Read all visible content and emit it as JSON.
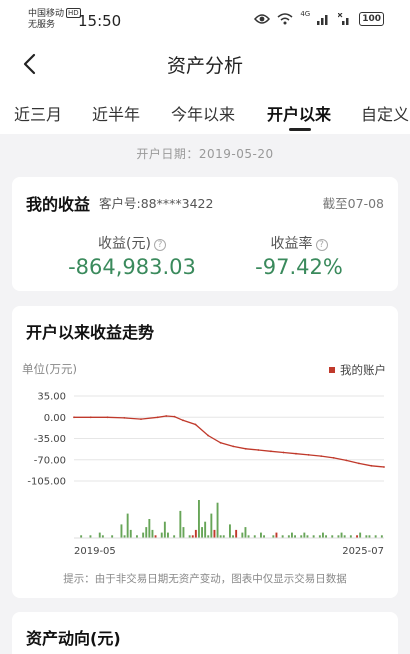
{
  "status_bar": {
    "carrier_line1": "中国移动",
    "carrier_badge": "HD",
    "carrier_line2": "无服务",
    "time": "15:50",
    "signal_label": "4G",
    "battery": "100"
  },
  "header": {
    "title": "资产分析"
  },
  "tabs": [
    {
      "label": "近三月",
      "active": false
    },
    {
      "label": "近半年",
      "active": false
    },
    {
      "label": "今年以来",
      "active": false
    },
    {
      "label": "开户以来",
      "active": true
    },
    {
      "label": "自定义",
      "active": false
    }
  ],
  "open_date": "开户日期：2019-05-20",
  "earnings_card": {
    "title": "我的收益",
    "customer_no": "客户号:88****3422",
    "as_of": "截至07-08",
    "profit_label": "收益(元)",
    "profit_value": "-864,983.03",
    "rate_label": "收益率",
    "rate_value": "-97.42%",
    "help_icon": "question-circle-icon",
    "value_color": "#3a8a5c"
  },
  "trend_card": {
    "title": "开户以来收益走势",
    "unit": "单位(万元)",
    "legend": "我的账户",
    "hint": "提示：由于非交易日期无资产变动，图表中仅显示交易日数据"
  },
  "chart_data": {
    "type": "line",
    "series": [
      {
        "name": "我的账户",
        "color": "#c0392b",
        "x": [
          "2019-05",
          "2019-09",
          "2020-01",
          "2020-05",
          "2020-09",
          "2021-01",
          "2021-03",
          "2021-05",
          "2021-07",
          "2021-10",
          "2022-01",
          "2022-04",
          "2022-07",
          "2022-10",
          "2023-01",
          "2023-04",
          "2023-07",
          "2023-10",
          "2024-01",
          "2024-04",
          "2024-07",
          "2024-10",
          "2025-01",
          "2025-04",
          "2025-07"
        ],
        "y": [
          0,
          0,
          0,
          -1,
          -3,
          0,
          2,
          1,
          -5,
          -12,
          -30,
          -42,
          -48,
          -52,
          -54,
          -56,
          -58,
          -60,
          -62,
          -64,
          -67,
          -71,
          -76,
          -80,
          -82
        ]
      }
    ],
    "bars": [
      0,
      0,
      1,
      0,
      0,
      1,
      0,
      0,
      2,
      1,
      0,
      0,
      1,
      0,
      0,
      5,
      1,
      9,
      3,
      0,
      1,
      0,
      2,
      4,
      7,
      3,
      1,
      0,
      2,
      6,
      2,
      0,
      1,
      0,
      10,
      4,
      0,
      1,
      1,
      3,
      14,
      4,
      6,
      1,
      9,
      3,
      13,
      1,
      1,
      0,
      5,
      1,
      3,
      0,
      2,
      4,
      1,
      0,
      1,
      0,
      2,
      1,
      0,
      0,
      1,
      2,
      0,
      1,
      0,
      1,
      2,
      1,
      0,
      1,
      2,
      1,
      0,
      1,
      0,
      1,
      2,
      1,
      0,
      1,
      0,
      1,
      2,
      1,
      0,
      1,
      0,
      1,
      2,
      0,
      1,
      1,
      0,
      1,
      0,
      1
    ],
    "bar_colors": [
      "#67a558",
      "#c0392b"
    ],
    "x_tick_labels": [
      "2019-05",
      "2025-07"
    ],
    "y_ticks": [
      35,
      0,
      -35,
      -70,
      -105
    ],
    "y_tick_labels": [
      "35.00",
      "0.00",
      "-35.00",
      "-70.00",
      "-105.00"
    ],
    "ylim": [
      -105,
      35
    ],
    "grid": true,
    "legend_position": "top-right"
  },
  "flow_card": {
    "title": "资产动向(元)"
  }
}
